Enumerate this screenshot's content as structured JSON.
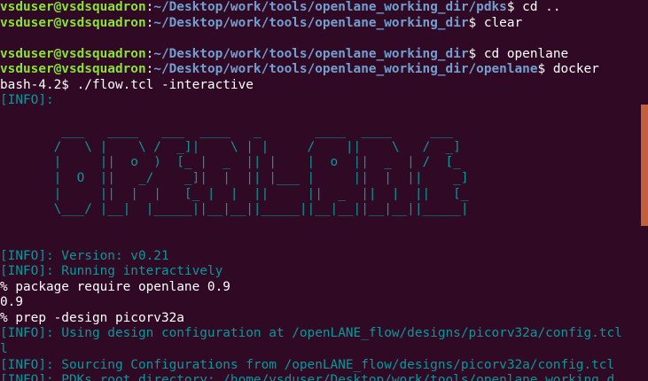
{
  "prompt": {
    "user": "vsduser@vsdsquadron",
    "sep": ":",
    "dollar": "$ "
  },
  "lines": {
    "l0": {
      "path": "~/Desktop/work/tools/openlane_working_dir/pdks",
      "cmd": "cd .."
    },
    "l1": {
      "path": "~/Desktop/work/tools/openlane_working_dir",
      "cmd": "clear"
    },
    "l3": {
      "path": "~/Desktop/work/tools/openlane_working_dir",
      "cmd": "cd openlane"
    },
    "l4": {
      "path": "~/Desktop/work/tools/openlane_working_dir/openlane",
      "cmd": "docker"
    },
    "l5": "bash-4.2$ ./flow.tcl -interactive",
    "l6": "[INFO]: "
  },
  "logo": [
    "        ___   ____   ___  ____   _       ____  ____     ___",
    "       /   \\ |    \\ /  _]|    \\ | |     /    ||    \\   /  _]",
    "       |     ||  o  )  [_ |  _  || |    |  o  ||  _  | /  [_",
    "       |  O  ||   _/    _]|  |  || |___ |     ||  |  ||    _]",
    "       |     ||  |  |   [_ |  |  ||     ||  _  ||  |  ||   [_",
    "       \\___/ |__|  |_____||__|__||_____||__|__||__|__||_____|"
  ],
  "output": [
    {
      "text": "[INFO]: Version: v0.21",
      "style": "info"
    },
    {
      "text": "[INFO]: Running interactively",
      "style": "info"
    },
    {
      "text": "% package require openlane 0.9",
      "style": "plain"
    },
    {
      "text": "0.9",
      "style": "plain"
    },
    {
      "text": "% prep -design picorv32a",
      "style": "plain"
    },
    {
      "text": "[INFO]: Using design configuration at /openLANE_flow/designs/picorv32a/config.tcl",
      "style": "info"
    },
    {
      "text": "l",
      "style": "info"
    },
    {
      "text": "[INFO]: Sourcing Configurations from /openLANE_flow/designs/picorv32a/config.tcl",
      "style": "info"
    },
    {
      "text": "[INFO]: PDKs root directory: /home/vsduser/Desktop/work/tools/openlane_working_d",
      "style": "info"
    }
  ],
  "colors": {
    "background": "#300a24",
    "user": "#8ae234",
    "path": "#729fcf",
    "info": "#06989a",
    "scroll_thumb": "#c0613b"
  }
}
